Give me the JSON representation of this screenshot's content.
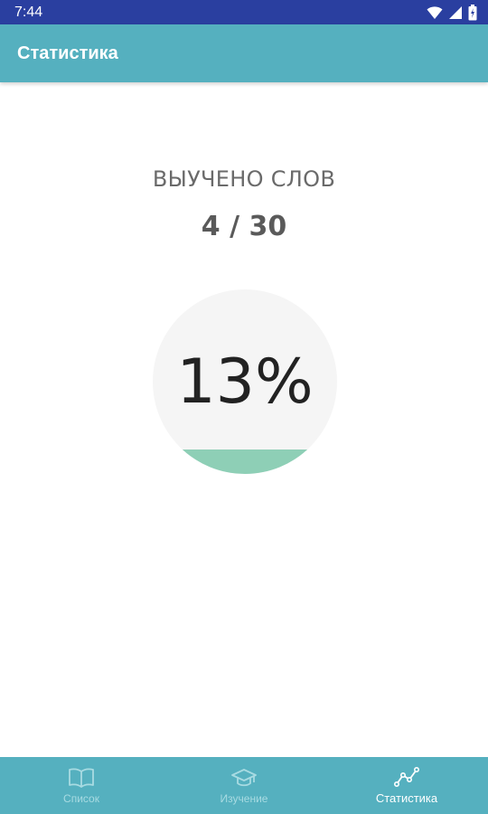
{
  "status_bar": {
    "time": "7:44",
    "icons": [
      "wifi-icon",
      "signal-icon",
      "battery-icon"
    ]
  },
  "app_bar": {
    "title": "Статистика"
  },
  "stats": {
    "learned_label": "ВЫУЧЕНО СЛОВ",
    "learned_count": "4 / 30",
    "percent_text": "13%",
    "progress_fraction": 0.13
  },
  "bottom_nav": {
    "items": [
      {
        "label": "Список",
        "icon": "book-icon",
        "active": false
      },
      {
        "label": "Изучение",
        "icon": "graduation-cap-icon",
        "active": false
      },
      {
        "label": "Статистика",
        "icon": "stats-line-icon",
        "active": true
      }
    ]
  },
  "colors": {
    "status_bar": "#2a3fa0",
    "app_bar": "#55b0bf",
    "progress_fill": "#8ecfb6",
    "circle_bg": "#f5f5f5"
  }
}
